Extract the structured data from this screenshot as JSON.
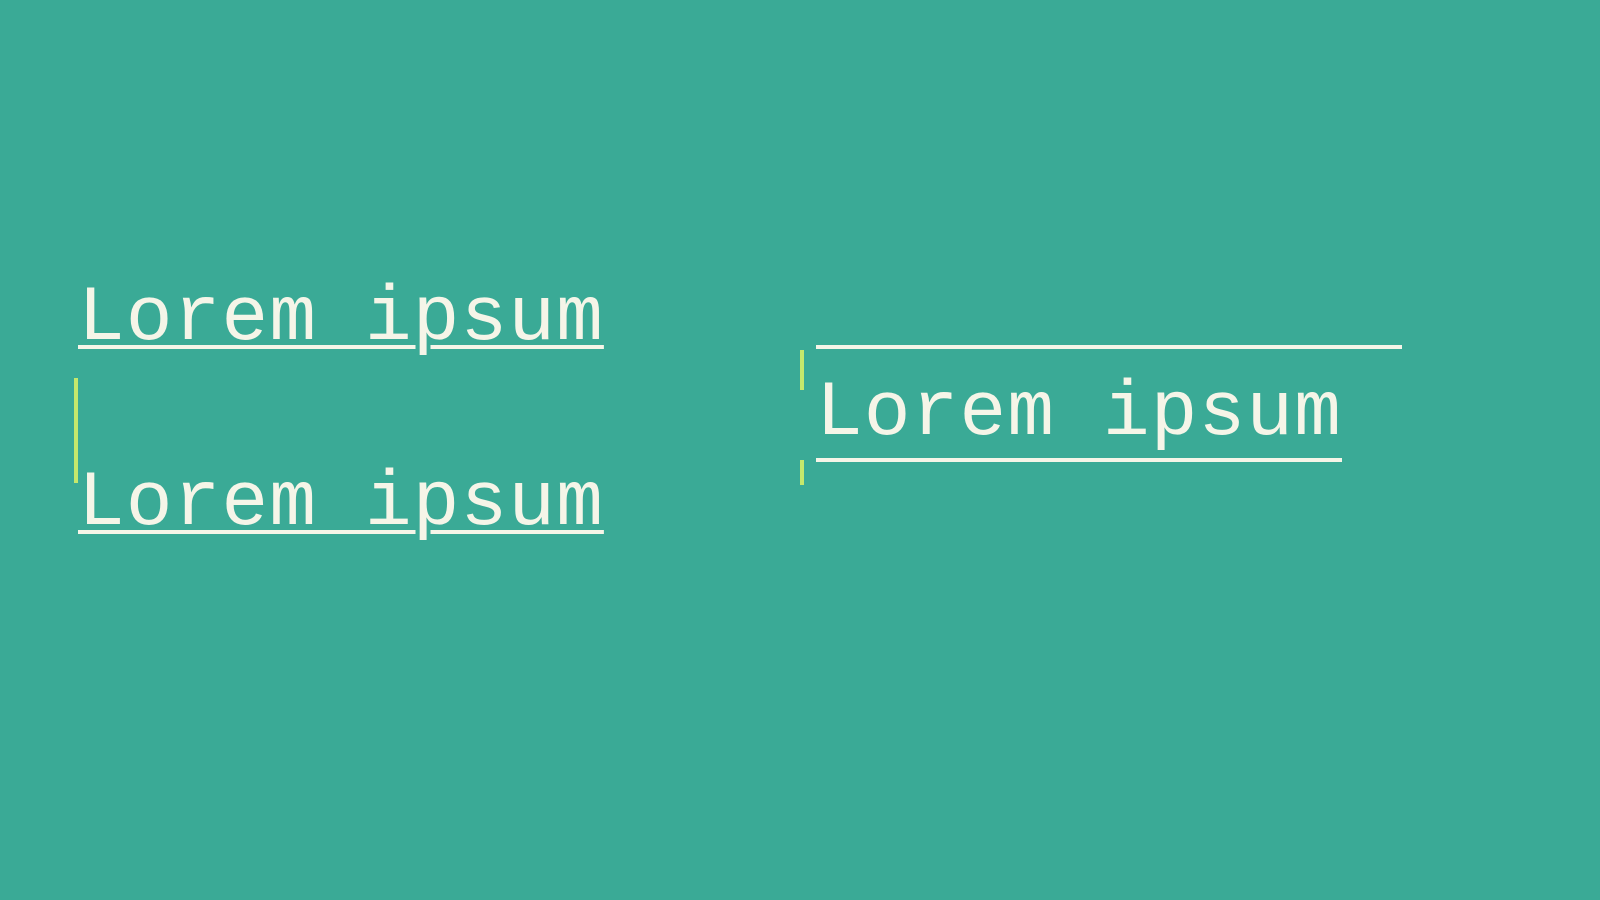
{
  "texts": {
    "block1": "Lorem ipsum",
    "block2": "Lorem ipsum",
    "block3": "Lorem ipsum"
  },
  "colors": {
    "background": "#3aaa96",
    "text": "#f5f5e8",
    "accent": "#c5e86c"
  }
}
